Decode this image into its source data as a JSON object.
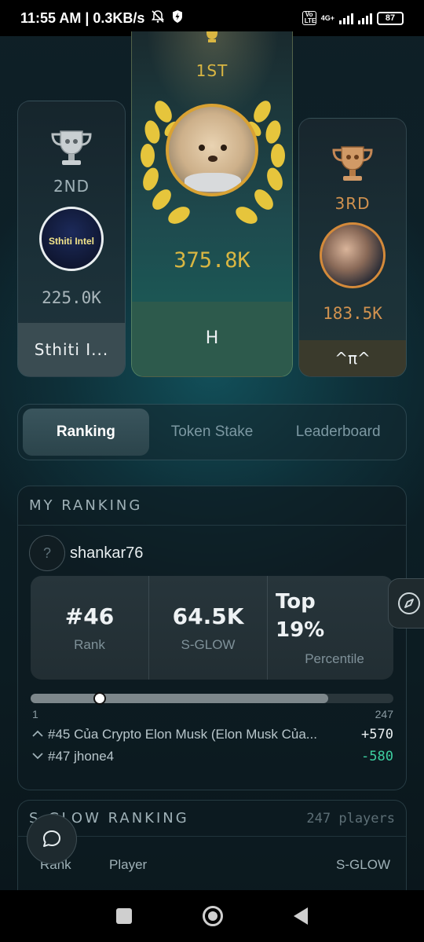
{
  "status_bar": {
    "time_speed": "11:55 AM | 0.3KB/s",
    "network": "4G+",
    "battery": "87",
    "volte": "Vo LTE"
  },
  "podium": {
    "first": {
      "place": "1ST",
      "score": "375.8K",
      "name": "H"
    },
    "second": {
      "place": "2ND",
      "score": "225.0K",
      "name": "Sthiti I...",
      "avatar_text": "Sthiti Intel"
    },
    "third": {
      "place": "3RD",
      "score": "183.5K",
      "name": "^π^"
    }
  },
  "tabs": [
    "Ranking",
    "Token Stake",
    "Leaderboard"
  ],
  "active_tab": "Ranking",
  "my_ranking": {
    "title": "MY RANKING",
    "avatar_placeholder": "?",
    "username": "shankar76",
    "rank_value": "#46",
    "rank_label": "Rank",
    "sglow_value": "64.5K",
    "sglow_label": "S-GLOW",
    "top_line1": "Top",
    "top_line2": "19%",
    "percentile_label": "Percentile",
    "progress": {
      "min": "1",
      "max": "247",
      "current_rank": 46,
      "knob_fraction": 0.19,
      "fill_fraction": 0.82
    },
    "above": {
      "text": "#45 Của Crypto Elon Musk (Elon Musk Của...",
      "diff": "+570"
    },
    "below": {
      "text": "#47 jhone4",
      "diff": "-580"
    }
  },
  "sglow_ranking": {
    "title": "S-GLOW RANKING",
    "player_count": "247 players",
    "columns": [
      "Rank",
      "Player",
      "S-GLOW"
    ]
  },
  "colors": {
    "gold": "#d9b642",
    "silver": "#9fb1b7",
    "bronze": "#d1924f",
    "positive": "#e9eef0",
    "negative": "#3dcfa0"
  },
  "icons": {
    "compass": "compass-icon",
    "chat": "chat-bubble-icon"
  }
}
